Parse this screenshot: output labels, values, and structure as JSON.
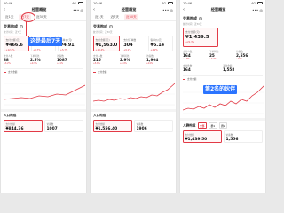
{
  "status": {
    "time": "10:46",
    "signal": "4G",
    "battery": ""
  },
  "nav": {
    "title": "经营概览",
    "back_icon": "chevron-left-icon",
    "more_icon": "more-icon"
  },
  "panels": [
    {
      "tabs": [
        "近1天",
        "近7天",
        "近30天"
      ],
      "active_tab": 1,
      "section_title": "交易构成",
      "note": "统计时间：近7天",
      "kpis": [
        {
          "label": "支付金额(元)",
          "value": "¥466.6",
          "change": "+12.8%",
          "highlight": true
        },
        {
          "label": "支付订单数",
          "value": "95",
          "change": "+6.7%",
          "highlight": false
        },
        {
          "label": "客单价(元)",
          "value": "¥4.91",
          "change": "+5.7%",
          "highlight": false
        }
      ],
      "grid": [
        {
          "label": "支付人数",
          "value": "88",
          "change": "+3.2%"
        },
        {
          "label": "下单转化",
          "value": "2.5%",
          "change": "+0.3%"
        },
        {
          "label": "访客数",
          "value": "1087",
          "change": "+11%"
        }
      ],
      "legend": "支付金额",
      "bottom_title": "入口构成",
      "bottom_cards": [
        {
          "label": "支付金额",
          "value": "¥844.36",
          "highlight": true
        },
        {
          "label": "访客数",
          "value": "1007",
          "highlight": false
        }
      ]
    },
    {
      "tabs": [
        "近1天",
        "近7天",
        "近30天"
      ],
      "active_tab": 2,
      "section_title": "交易构成",
      "note": "统计时间：近30天",
      "kpis": [
        {
          "label": "支付金额(元)",
          "value": "¥1,563.0",
          "change": "+18.4%",
          "highlight": true
        },
        {
          "label": "支付订单数",
          "value": "304",
          "change": "+9.1%",
          "highlight": false
        },
        {
          "label": "客单价(元)",
          "value": "¥5.14",
          "change": "+4.2%",
          "highlight": false
        }
      ],
      "grid": [
        {
          "label": "支付人数",
          "value": "215",
          "change": "+5.6%"
        },
        {
          "label": "下单转化",
          "value": "2.9%",
          "change": "+0.4%"
        },
        {
          "label": "访客数",
          "value": "1,904",
          "change": "+14%"
        }
      ],
      "legend": "支付金额",
      "bottom_title": "入口构成",
      "bottom_cards": [
        {
          "label": "支付金额",
          "value": "¥1,556.40",
          "highlight": true
        },
        {
          "label": "访客数",
          "value": "1906",
          "highlight": false
        }
      ]
    },
    {
      "tabs": [
        "近1天",
        "近7天",
        "近30天"
      ],
      "active_tab": 2,
      "section_title": "交易构成",
      "note": "统计时间：近30天",
      "big_kpi": {
        "label": "支付金额(元)",
        "value": "¥1,439.5",
        "change": "+21.3%"
      },
      "grid": [
        {
          "label": "支付人数",
          "value": "164",
          "change": "+4.8%"
        },
        {
          "label": "下单转化",
          "value": "25",
          "change": "+0.2%"
        },
        {
          "label": "访客数",
          "value": "2,556",
          "change": "+16%"
        }
      ],
      "grid2": [
        {
          "label": "支付件数",
          "value": "164",
          "change": ""
        },
        {
          "label": "退款金额",
          "value": "1,558",
          "change": ""
        }
      ],
      "legend": "支付金额",
      "bottom_title": "入群构成",
      "chips": [
        "全部",
        "群1",
        "群2"
      ],
      "bottom_cards": [
        {
          "label": "支付金额",
          "value": "¥1,439.50",
          "highlight": true
        },
        {
          "label": "访客数",
          "value": "1,556",
          "highlight": false
        }
      ]
    }
  ],
  "annotations": {
    "first": "这是最后7天",
    "second": "第2名的伙伴"
  },
  "colors": {
    "accent": "#e23a46",
    "annotation": "#2b74ff"
  }
}
